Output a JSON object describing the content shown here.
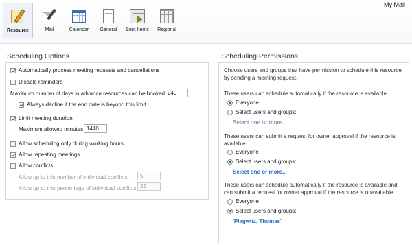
{
  "header": {
    "account_label": "My Mail",
    "tabs": [
      {
        "label": "Resource",
        "icon": "resource-icon",
        "active": true
      },
      {
        "label": "Mail",
        "icon": "mail-icon",
        "active": false
      },
      {
        "label": "Calendar",
        "icon": "calendar-icon",
        "active": false
      },
      {
        "label": "General",
        "icon": "general-icon",
        "active": false
      },
      {
        "label": "Sent Items",
        "icon": "sent-items-icon",
        "active": false
      },
      {
        "label": "Regional",
        "icon": "regional-icon",
        "active": false
      }
    ]
  },
  "scheduling_options": {
    "title": "Scheduling Options",
    "auto_process": {
      "label": "Automatically process meeting requests and cancellations",
      "checked": true
    },
    "disable_reminders": {
      "label": "Disable reminders",
      "checked": false
    },
    "max_days": {
      "label": "Maximum number of days in advance resources can be booked:",
      "value": "240"
    },
    "always_decline": {
      "label": "Always decline if the end date is beyond this limit",
      "checked": true
    },
    "limit_duration": {
      "label": "Limit meeting duration",
      "checked": true
    },
    "max_minutes": {
      "label": "Maximum allowed minutes:",
      "value": "1440"
    },
    "working_hours": {
      "label": "Allow scheduling only during working hours",
      "checked": false
    },
    "repeating": {
      "label": "Allow repeating meetings",
      "checked": true
    },
    "conflicts": {
      "label": "Allow conflicts",
      "checked": false
    },
    "conflicts_number": {
      "label": "Allow up to this number of individual conflicts:",
      "value": "5"
    },
    "conflicts_percentage": {
      "label": "Allow up to this percentage of individual conflicts:",
      "value": "25"
    }
  },
  "scheduling_permissions": {
    "title": "Scheduling Permissions",
    "intro": "Choose users and groups that have permission to schedule this resource by sending a meeting request.",
    "section1": {
      "text": "These users can schedule automatically if the resource is available.",
      "everyone": "Everyone",
      "select": "Select users and groups:",
      "selected": "everyone",
      "link": "Select one or more..."
    },
    "section2": {
      "text": "These users can submit a request for owner approval if the resource is available.",
      "everyone": "Everyone",
      "select": "Select users and groups:",
      "selected": "select",
      "link": "Select one or more..."
    },
    "section3": {
      "text": "These users can schedule automatically if the resource is available and can submit a request for owner approval if the resource is unavailable.",
      "everyone": "Everyone",
      "select": "Select users and groups:",
      "selected": "select",
      "link": "'Plagwitz, Thomas'"
    }
  }
}
